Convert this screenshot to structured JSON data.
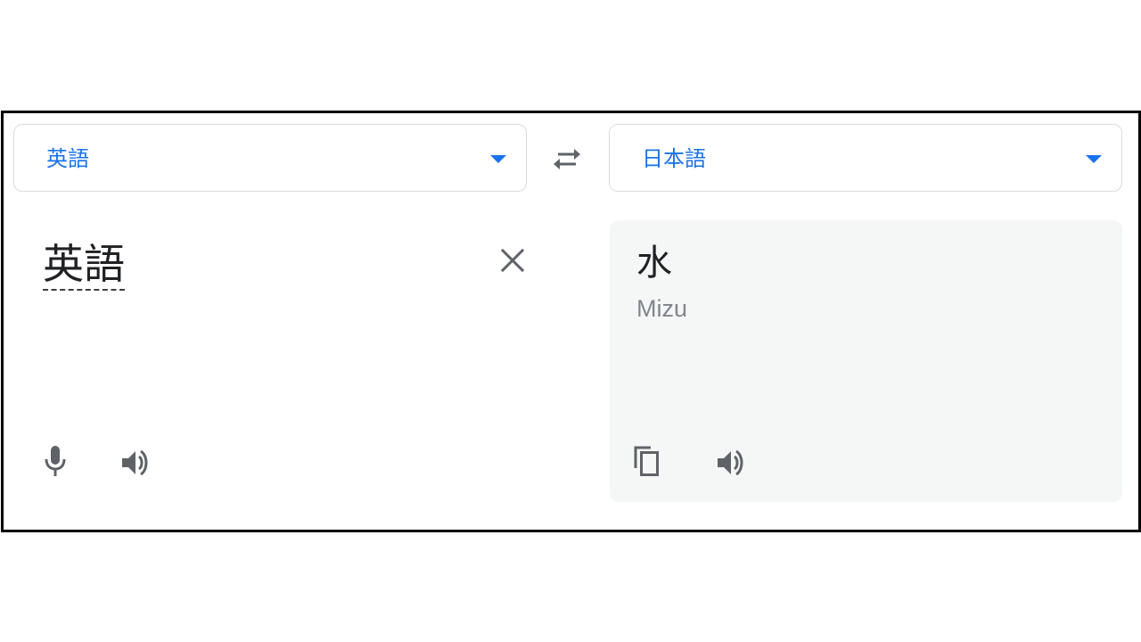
{
  "source_language": {
    "label": "英語",
    "icon": "arrow-drop-down-icon"
  },
  "target_language": {
    "label": "日本語",
    "icon": "arrow-drop-down-icon"
  },
  "swap": {
    "icon": "swap-horiz-icon"
  },
  "source": {
    "text": "英語",
    "clear_icon": "close-icon",
    "mic_icon": "mic-icon",
    "listen_icon": "volume-up-icon"
  },
  "target": {
    "text": "水",
    "romanization": "Mizu",
    "copy_icon": "content-copy-icon",
    "listen_icon": "volume-up-icon"
  },
  "colors": {
    "accent": "#1a73e8",
    "icon_gray": "#5f6368",
    "panel_bg": "#f5f7f7",
    "romanization_gray": "#80868b",
    "frame_border": "#000000"
  }
}
